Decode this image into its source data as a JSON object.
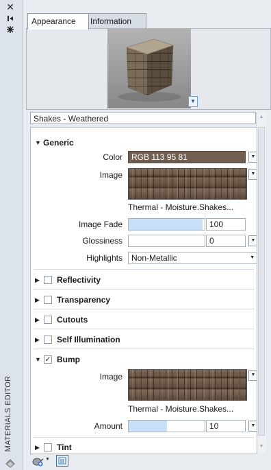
{
  "palette": {
    "title": "MATERIALS EDITOR",
    "close_icon": "close-icon",
    "autohide_icon": "autohide-pin-icon",
    "properties_icon": "properties-icon",
    "palette_icon": "materials-icon"
  },
  "tabs": [
    {
      "label": "Appearance",
      "active": true
    },
    {
      "label": "Information",
      "active": false
    }
  ],
  "material_name": "Shakes - Weathered",
  "generic": {
    "header": "Generic",
    "expanded": true,
    "color_label": "Color",
    "color_value": "RGB 113 95 81",
    "color_swatch": "#715f51",
    "image_label": "Image",
    "image_name": "Thermal - Moisture.Shakes...",
    "image_fade_label": "Image Fade",
    "image_fade_value": "100",
    "image_fade_fraction": 0.97,
    "glossiness_label": "Glossiness",
    "glossiness_value": "0",
    "glossiness_fraction": 0.0,
    "highlights_label": "Highlights",
    "highlights_value": "Non-Metallic"
  },
  "sections": [
    {
      "label": "Reflectivity",
      "checked": false,
      "expanded": false
    },
    {
      "label": "Transparency",
      "checked": false,
      "expanded": false
    },
    {
      "label": "Cutouts",
      "checked": false,
      "expanded": false
    },
    {
      "label": "Self Illumination",
      "checked": false,
      "expanded": false
    }
  ],
  "bump": {
    "label": "Bump",
    "checked": true,
    "expanded": true,
    "check_glyph": "✓",
    "image_label": "Image",
    "image_name": "Thermal - Moisture.Shakes...",
    "amount_label": "Amount",
    "amount_value": "10",
    "amount_fraction": 0.5
  },
  "tint": {
    "label": "Tint",
    "checked": false,
    "expanded": false
  },
  "bottom_bar": {
    "create_material_icon": "create-material-icon",
    "material_browser_icon": "material-browser-icon"
  }
}
